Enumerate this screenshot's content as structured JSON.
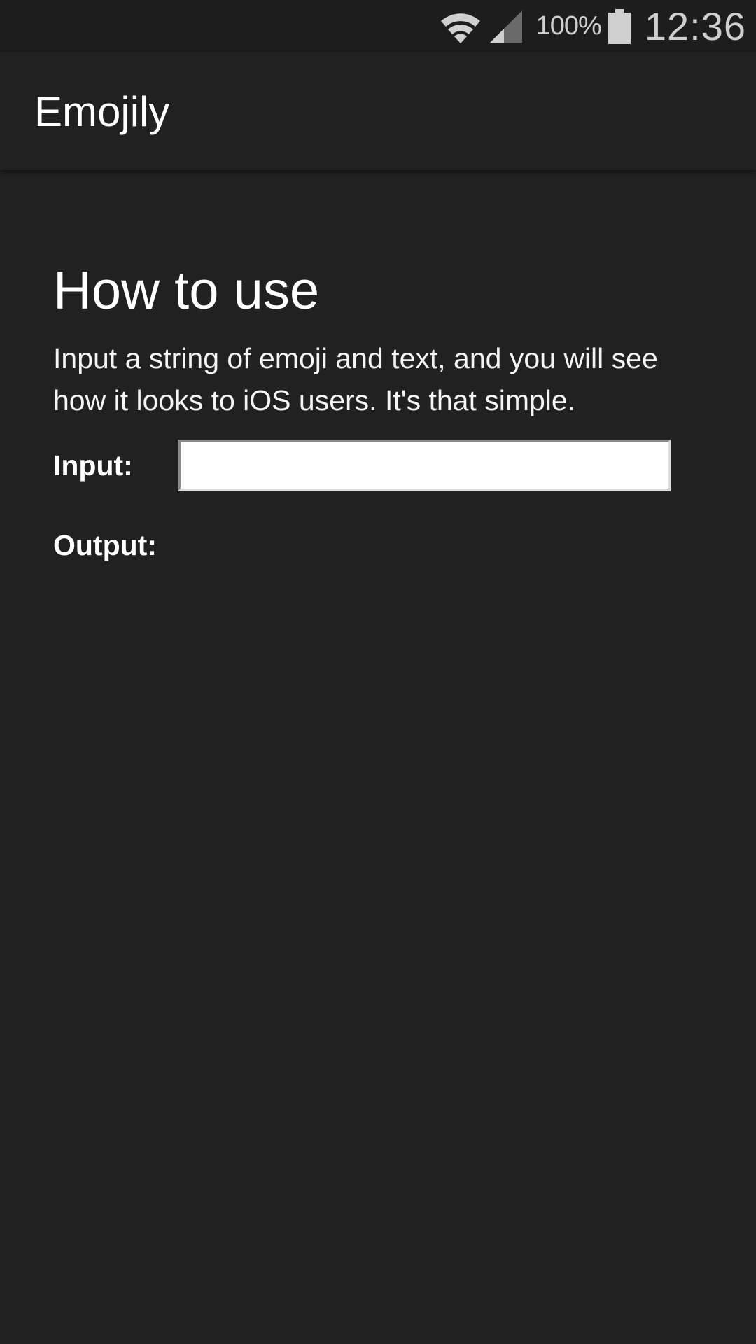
{
  "status_bar": {
    "battery_percent": "100%",
    "time": "12:36",
    "icons": [
      "wifi-icon",
      "signal-icon",
      "battery-icon"
    ]
  },
  "app_bar": {
    "title": "Emojily"
  },
  "main": {
    "heading": "How to use",
    "description": "Input a string of emoji and text, and you will see how it looks to iOS users. It's that simple.",
    "input_label": "Input:",
    "input_value": "",
    "output_label": "Output:",
    "output_value": ""
  },
  "colors": {
    "background": "#212121",
    "status_bar": "#1d1d1d",
    "text": "#ffffff",
    "input_background": "#ffffff"
  }
}
